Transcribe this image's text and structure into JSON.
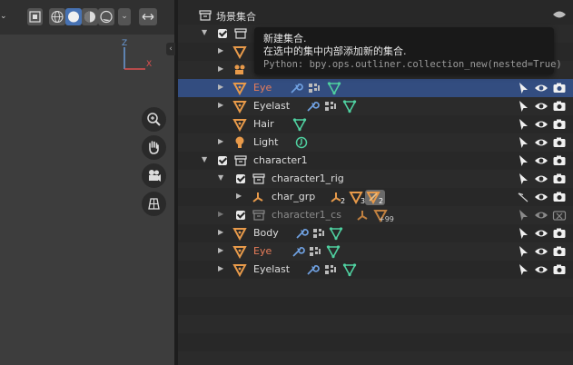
{
  "viewport": {
    "axes": {
      "z": "Z",
      "x": "X"
    }
  },
  "outliner": {
    "root_label": "场景集合",
    "tooltip": {
      "title": "新建集合.",
      "description": "在选中的集中内部添加新的集合.",
      "python": "Python: bpy.ops.outliner.collection_new(nested=True)"
    },
    "rows": [
      {
        "label": "Eye",
        "style": "red",
        "selected": true
      },
      {
        "label": "Eyelast"
      },
      {
        "label": "Hair"
      },
      {
        "label": "Light"
      },
      {
        "label": "character1"
      },
      {
        "label": "character1_rig"
      },
      {
        "label": "char_grp",
        "badges": [
          "2",
          "3",
          "2"
        ]
      },
      {
        "label": "character1_cs",
        "style": "dim",
        "badge": "+99"
      },
      {
        "label": "Body"
      },
      {
        "label": "Eye",
        "style": "red"
      },
      {
        "label": "Eyelast"
      }
    ]
  },
  "colors": {
    "selection": "#334d80",
    "object_orange": "#e89a4a",
    "modifier_blue": "#6fa0e0",
    "mesh_green": "#4fd0a0",
    "red_text": "#e87d5a"
  }
}
